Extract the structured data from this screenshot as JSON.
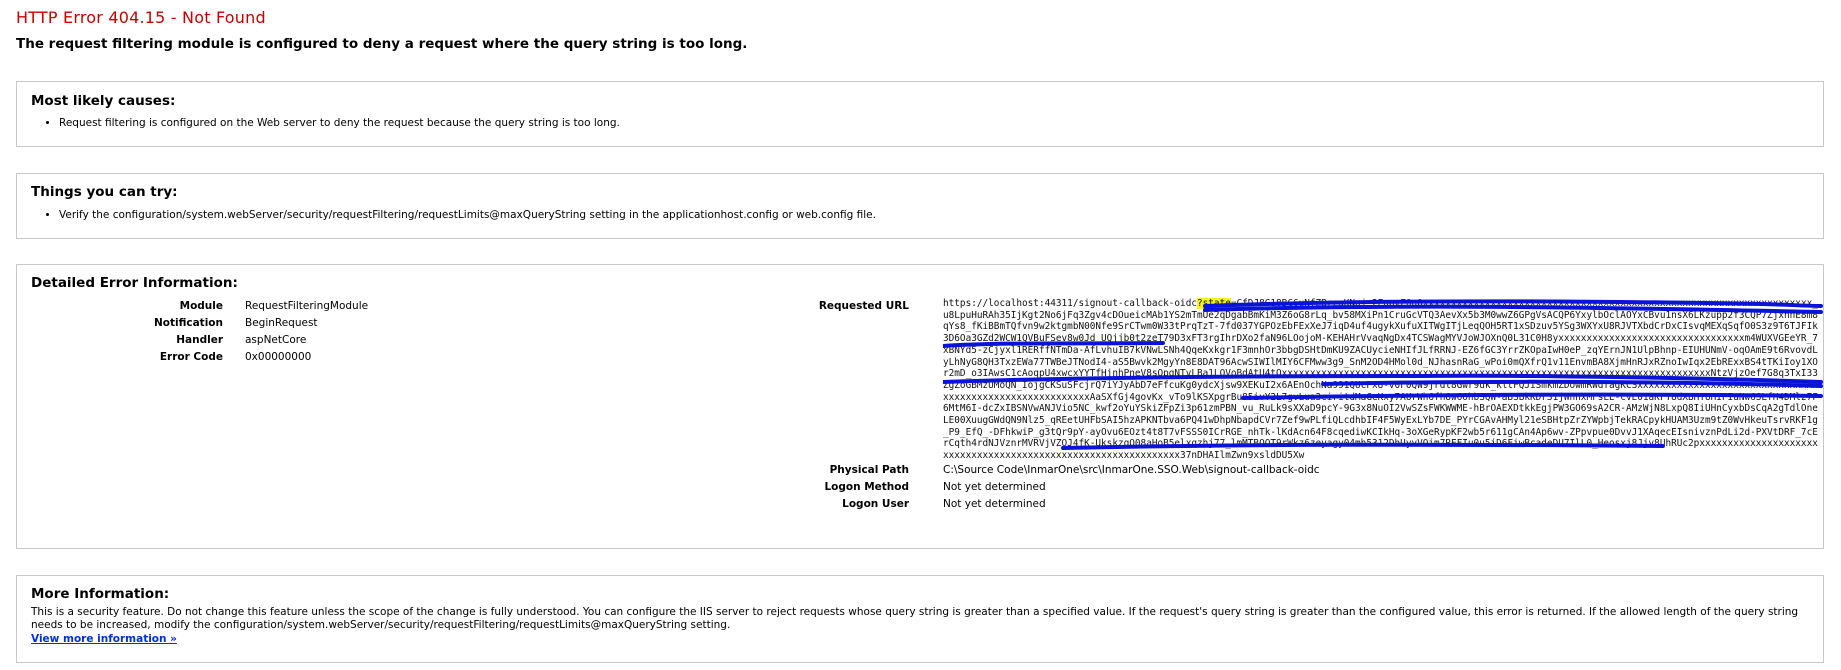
{
  "header": {
    "title": "HTTP Error 404.15 - Not Found",
    "subtitle": "The request filtering module is configured to deny a request where the query string is too long."
  },
  "causes": {
    "heading": "Most likely causes:",
    "items": [
      "Request filtering is configured on the Web server to deny the request because the query string is too long."
    ]
  },
  "try": {
    "heading": "Things you can try:",
    "items": [
      "Verify the configuration/system.webServer/security/requestFiltering/requestLimits@maxQueryString setting in the applicationhost.config or web.config file."
    ]
  },
  "details": {
    "heading": "Detailed Error Information:",
    "left": [
      {
        "key": "Module",
        "value": "RequestFilteringModule"
      },
      {
        "key": "Notification",
        "value": "BeginRequest"
      },
      {
        "key": "Handler",
        "value": "aspNetCore"
      },
      {
        "key": "Error Code",
        "value": "0x00000000"
      }
    ],
    "requested_url_label": "Requested URL",
    "requested_url_before": "https://localhost:44311/signout-callback-oidc",
    "requested_url_highlight": "?state",
    "requested_url_after": "=CfDJ8G18BC6uNfZBrzaKNoj_2EgpvFQq0xxxxxxxxxxxxxxxxxxxxxxxxxxxxxxxxxxxxxxxxxxxxxxxxxxxxxxxxxxxxxxxxxxxxx_u8LpuHuRAh35IjKgt2No6jFq3Zgv4cDOueicMAb1YS2mTmUe2qDgabBmKiM3Z6oG8rLq_bv58MXiPn1CruGcVTQ3AevXx5b3M0wwZ6GPgVsACQP6YxylbOclAOYxCBvu1nsX6LKzupp2f3CQP7ZjxhhE8m8qYs8_fKiBBmTQfvn9w2ktgmbN00Nfe9SrCTwm0W33tPrqTzT-7fd037YGPOzEbFExXeJ7iqD4uf4ugykXufuXITWgITjLeqQOH5RT1xSDzuv5YSg3WXYxU8RJVTXbdCrDxCIsvqMEXqSqfO0S3z9T6TJFIk3D6Oa3GZd2WCW1QVBuFSev8w0Jd_UQjjb0t2zeT79D3xFT3rgIhrDXo2faN96LOojoM-KEHAHrVvaqNgDx4TCSWagMYVJoWJOXnQ0L31C0H8yxxxxxxxxxxxxxxxxxxxxxxxxxxxxxxxxxm4WUXVGEeYR_7xBNYd5-zCjyxl1RERffNTmDa-AfLvhuIB7kVNwLSNh4QqeKxkgr1F3mnhOr3bbgDSHtDmKU9ZACUycieNHIfJLfRRNJ-EZ6fGC3YrrZKOpaIwH0eP_zqYErnJN1UlpBhnp-EIUHUNmV-oqOAmE9t6RvovdLyLhNyG8QH3TxzEWa77TWBeJTNodI4-aS5Bwvk2MgyYn8E8DAT96AcwSIWIlMIY6CFMww3g9_SnM2OD4HMol0d_NJhasnRaG_wPoi0mQXfrQ1v11EnvmBA8XjmHnRJxRZnoIwIqx2EbRExxBS4tTKiIoy1XOr2mD_o3IAwsC1cAoqpU4xwcxYYTfHjnhPneV8sOpgNTvLBa1LOVoBdAtU4tQxxxxxxxxxxxxxxxxxxxxxxxxxxxxxxxxxxxxxxxxxxxxxxxxxxxxxxxxxxxxxxxxxxxxxxxxxxxxNtzVjzOef7G8q3TxI33ZgZoGBMzUMoQN_IojgCKSuSFcjrQ7iYJyAbD7eFfcuKg0ydcXjsw9XEKuI2x6AEnOchNa991QUcPx8-v0F0QW9jrdt8Gwr9uk_kltFQJiSmkmZDowmRWdfagKCSxxxxxxxxxxxxxxxxxxxxxxxxxxxxxxxxxxxxxxxxxxxxxxxxxxxxxxxxxxAaSXfGj4govKx_vTo9lKSXpgrBu85ivY2L7gvLua3ciritdMaGeKxy7AUrWh6fh8w6OhbSQW-aBSBkKDr31jWnnxMFsLE-cvE01aKFT8dXBHTUHIPIaNw6SLfH4DMlz7F6MtM6I-dcZxIBSNVwANJVio5NC_kwf2oYuYSkiZFpZi3p61zmPBN_vu_RuLk9sXXaD9pcY-9G3x8NuOI2VwSZsFWKWWME-hBrOAEXDtkkEgjPW3GO69sA2CR-AMzWjN8LxpQ8IiUHnCyxbDsCqA2gTdlOneLE00XuugGWdQN9Nlz5_qREetUHFbSAI5hzAPKNTbva6PQ41wDhpNbapdCVr7Zef9wPLfiQLcdhbIF4F5WyExLYb7DE_PYrCGAvAHMyl21eSBHtpZrZYWpbjTekRACpykHUAM3Uzm9tZ0WvHkeuTsrvRKF1g_P9_EfQ_-DFhkwiP_g3tQr9pY-ayOvu6EOzt4t8T7vFSSS0ICrRGE_nhTk-lKdAcn64F8cqediwKCIkHq-3oXGeRypKF2wb5r611gCAn4Ap6wv-ZPpvpue0DvvJ1XAqecEIsnivznPdLi2d-PXVtDRF_7cErCqth4rdNJVznrMVRVjVZOJ4fK-UkskzqO08aHoB5elxqzhj77_lmMTBQOT9rWkz6zeyagy04mh5312DhUyvVOim7REFIu0u5iD6FiwBcadeDU7IlL0_Heosxj8Jjv8UhRUc2pxxxxxxxxxxxxxxxxxxxxxxxxxxxxxxxxxxxxxxxxxxxxxxxxxxxxxxxxxxxxxxx37nDHAIlmZwn9xsldDU5Xw",
    "right": [
      {
        "key": "Physical Path",
        "value": "C:\\Source Code\\InmarOne\\src\\InmarOne.SSO.Web\\signout-callback-oidc"
      },
      {
        "key": "Logon Method",
        "value": "Not yet determined"
      },
      {
        "key": "Logon User",
        "value": "Not yet determined"
      }
    ]
  },
  "more": {
    "heading": "More Information:",
    "text": "This is a security feature. Do not change this feature unless the scope of the change is fully understood. You can configure the IIS server to reject requests whose query string is greater than a specified value. If the request's query string is greater than the configured value, this error is returned. If the allowed length of the query string needs to be increased, modify the configuration/system.webServer/security/requestFiltering/requestLimits@maxQueryString setting.",
    "link": "View more information »"
  },
  "colors": {
    "title": "#cc0000",
    "link": "#0033cc",
    "highlight": "#f5f125",
    "scribble": "#0a14d8"
  }
}
